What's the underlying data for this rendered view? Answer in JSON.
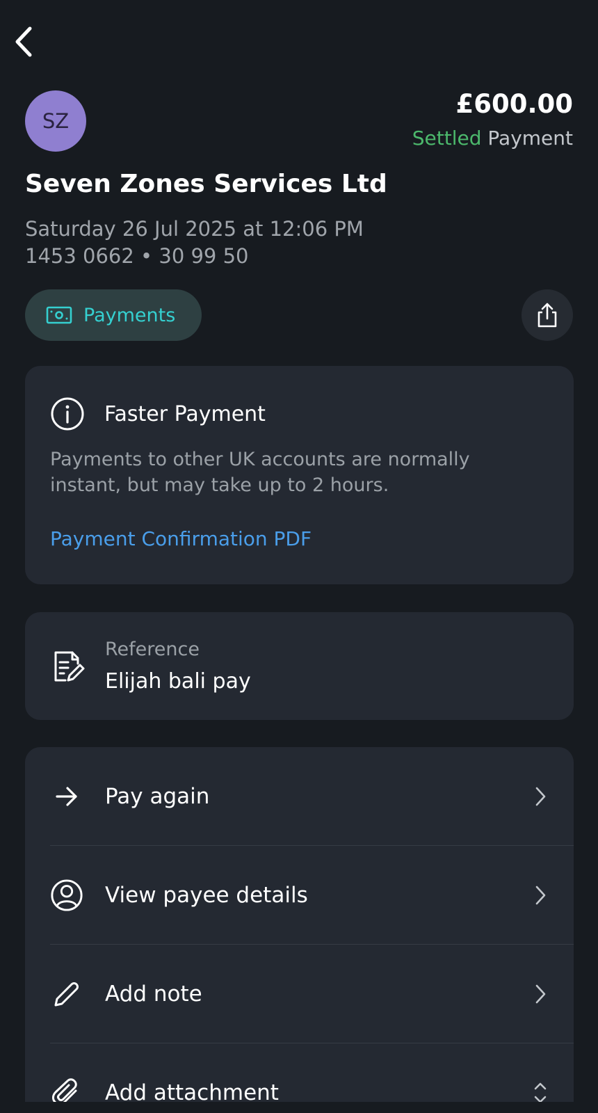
{
  "header": {
    "back_icon": "chevron-left-icon"
  },
  "transaction": {
    "avatar_initials": "SZ",
    "amount": "£600.00",
    "status": "Settled",
    "type": "Payment",
    "payee_name": "Seven Zones Services Ltd",
    "datetime": "Saturday 26 Jul 2025 at 12:06 PM",
    "account_line": "1453 0662 • 30 99 50"
  },
  "category": {
    "label": "Payments",
    "icon": "banknote-icon"
  },
  "share": {
    "icon": "share-icon"
  },
  "info_card": {
    "title": "Faster Payment",
    "description": "Payments to other UK accounts are normally instant, but may take up to 2 hours.",
    "link": "Payment Confirmation PDF"
  },
  "reference": {
    "label": "Reference",
    "value": "Elijah bali pay"
  },
  "actions": [
    {
      "label": "Pay again",
      "icon": "arrow-right-icon"
    },
    {
      "label": "View payee details",
      "icon": "user-circle-icon"
    },
    {
      "label": "Add note",
      "icon": "pencil-icon"
    },
    {
      "label": "Add attachment",
      "icon": "paperclip-icon"
    }
  ],
  "colors": {
    "background": "#171b20",
    "card": "#242932",
    "settled_green": "#4cb86c",
    "chip_text": "#35d0d0",
    "link_blue": "#4a9eea",
    "avatar": "#8f7fd0"
  }
}
